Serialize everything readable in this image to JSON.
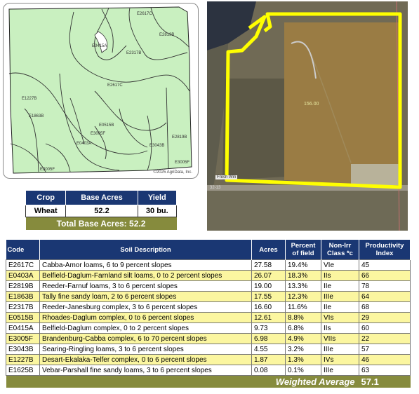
{
  "soil_map": {
    "labels": [
      "E2617C",
      "E0415A",
      "E2819B",
      "E2317B",
      "E2617C",
      "E1227B",
      "E1863B",
      "E0515B",
      "E3005F",
      "E0403A",
      "E3043B",
      "E2819B",
      "E3005F",
      "E3005F"
    ],
    "credit": "©2025 AgriData, Inc."
  },
  "aerial": {
    "acres_label": "156.00",
    "road_label": "Fresh Win",
    "road_label2": "32-13"
  },
  "crop_table": {
    "headers": [
      "Crop",
      "Base Acres",
      "Yield"
    ],
    "rows": [
      [
        "Wheat",
        "52.2",
        "30 bu."
      ]
    ],
    "total_label": "Total Base Acres:",
    "total_value": "52.2"
  },
  "soil_table": {
    "headers": {
      "code": "Code",
      "desc": "Soil Description",
      "acres": "Acres",
      "pct_1": "Percent",
      "pct_2": "of field",
      "class_1": "Non-Irr",
      "class_2": "Class *c",
      "pi_1": "Productivity",
      "pi_2": "Index"
    },
    "rows": [
      [
        "E2617C",
        "Cabba-Amor loams, 6 to 9 percent slopes",
        "27.58",
        "19.4%",
        "VIe",
        "45"
      ],
      [
        "E0403A",
        "Belfield-Daglum-Farnland silt loams, 0 to 2 percent slopes",
        "26.07",
        "18.3%",
        "IIs",
        "66"
      ],
      [
        "E2819B",
        "Reeder-Farnuf loams, 3 to 6 percent slopes",
        "19.00",
        "13.3%",
        "IIe",
        "78"
      ],
      [
        "E1863B",
        "Tally fine sandy loam, 2 to 6 percent slopes",
        "17.55",
        "12.3%",
        "IIIe",
        "64"
      ],
      [
        "E2317B",
        "Reeder-Janesburg complex, 3 to 6 percent slopes",
        "16.60",
        "11.6%",
        "IIe",
        "68"
      ],
      [
        "E0515B",
        "Rhoades-Daglum complex, 0 to 6 percent slopes",
        "12.61",
        "8.8%",
        "VIs",
        "29"
      ],
      [
        "E0415A",
        "Belfield-Daglum complex, 0 to 2 percent slopes",
        "9.73",
        "6.8%",
        "IIs",
        "60"
      ],
      [
        "E3005F",
        "Brandenburg-Cabba complex, 6 to 70 percent slopes",
        "6.98",
        "4.9%",
        "VIIs",
        "22"
      ],
      [
        "E3043B",
        "Searing-Ringling loams, 3 to 6 percent slopes",
        "4.55",
        "3.2%",
        "IIIe",
        "57"
      ],
      [
        "E1227B",
        "Desart-Ekalaka-Telfer complex, 0 to 6 percent slopes",
        "1.87",
        "1.3%",
        "IVs",
        "46"
      ],
      [
        "E1625B",
        "Vebar-Parshall fine sandy loams, 3 to 6 percent slopes",
        "0.08",
        "0.1%",
        "IIIe",
        "63"
      ]
    ],
    "weighted_label": "Weighted Average",
    "weighted_value": "57.1"
  },
  "colors": {
    "header_navy": "#1a3773",
    "olive": "#868b3d",
    "highlight_yellow": "#fbf6a0",
    "map_green": "#c9f0c0",
    "boundary_yellow": "#ffff00"
  }
}
